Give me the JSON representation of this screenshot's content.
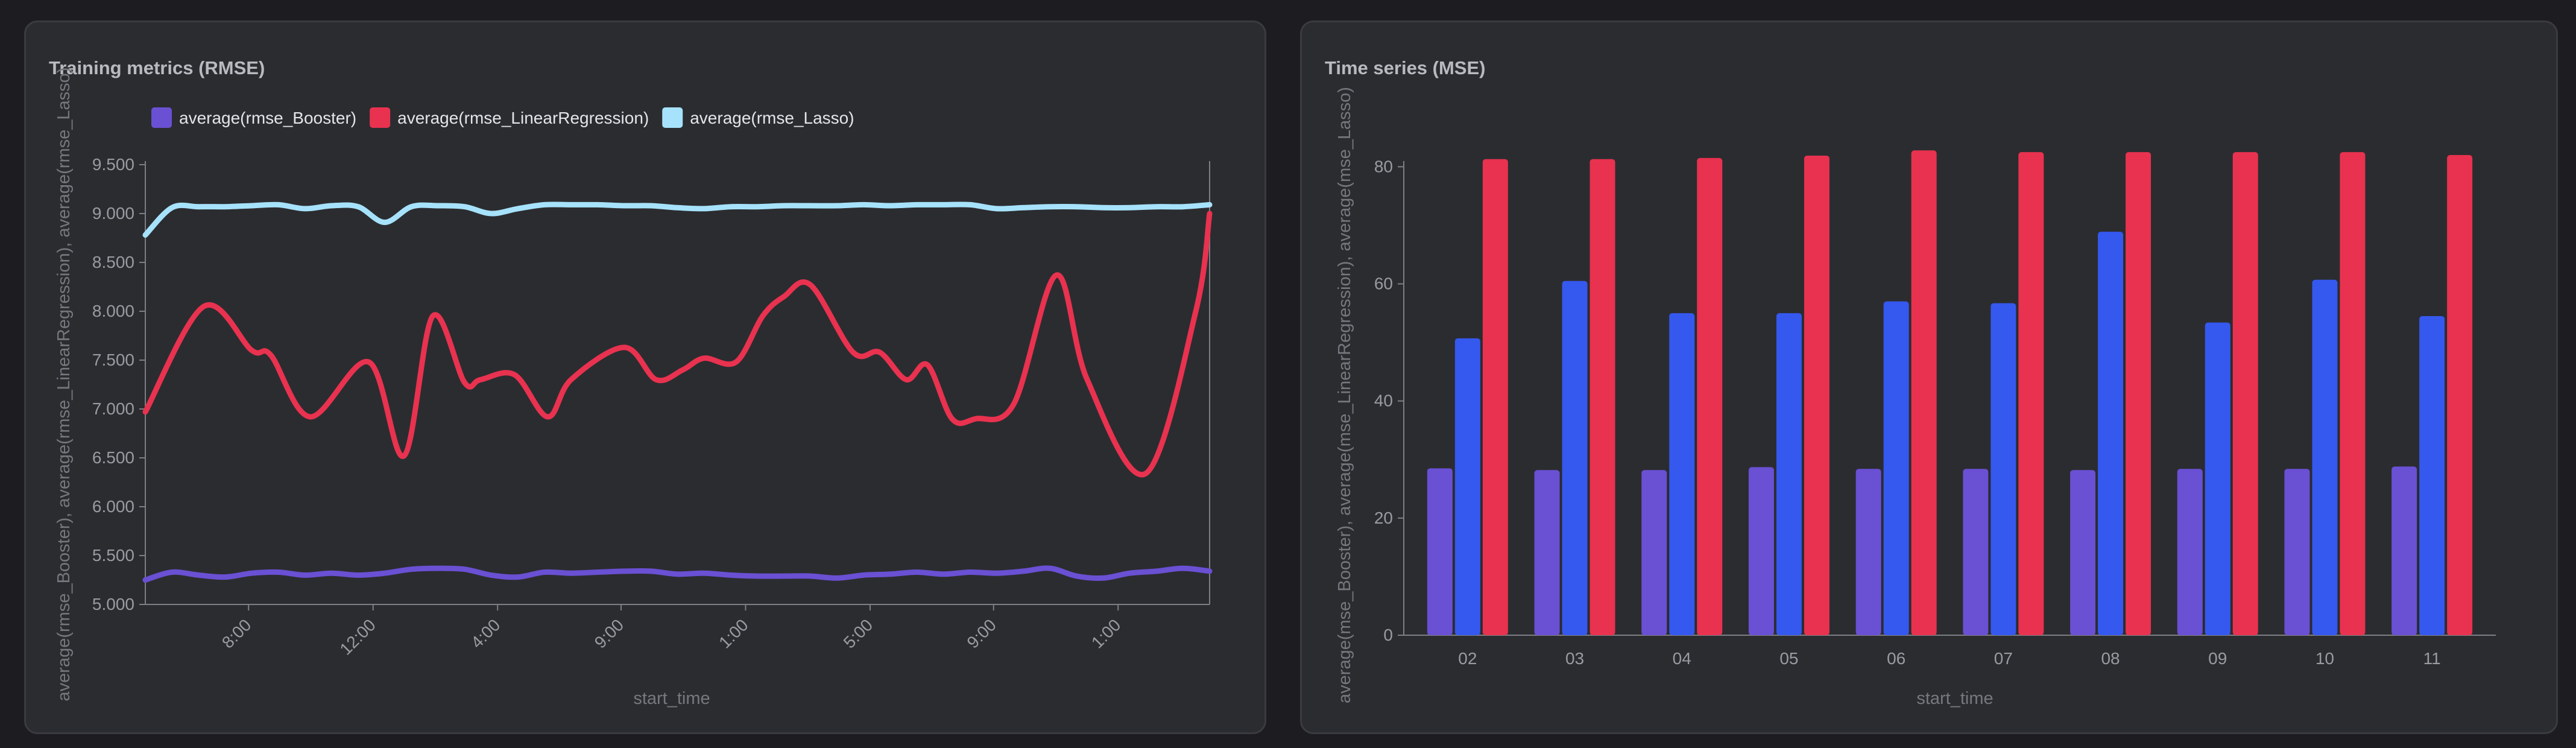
{
  "colors": {
    "booster": "#6a50d3",
    "linear": "#e8324f",
    "lasso": "#a6e2fb",
    "mse_booster": "#6a50d3",
    "mse_linear": "#3558ee",
    "mse_lasso": "#e8324f"
  },
  "panels": {
    "left": {
      "title": "Training metrics (RMSE)",
      "chart_data": {
        "type": "line",
        "title": "Training metrics (RMSE)",
        "xlabel": "start_time",
        "ylabel": "average(rmse_Booster), average(rmse_LinearRegression), average(rmse_Lasso)",
        "ylim": [
          5.0,
          9.5
        ],
        "y_ticks": [
          "5.000",
          "5.500",
          "6.000",
          "6.500",
          "7.000",
          "7.500",
          "8.000",
          "8.500",
          "9.000",
          "9.500"
        ],
        "x_range": [
          0,
          1.0
        ],
        "x_ticks": [
          {
            "x": 0.097,
            "label": "8:00"
          },
          {
            "x": 0.214,
            "label": "12:00"
          },
          {
            "x": 0.331,
            "label": "4:00"
          },
          {
            "x": 0.447,
            "label": "9:00"
          },
          {
            "x": 0.564,
            "label": "1:00"
          },
          {
            "x": 0.681,
            "label": "5:00"
          },
          {
            "x": 0.797,
            "label": "9:00"
          },
          {
            "x": 0.914,
            "label": "1:00"
          }
        ],
        "legend_position": "top-left",
        "series": [
          {
            "name": "average(rmse_Booster)",
            "color_key": "booster",
            "x": [
              0,
              0.025,
              0.05,
              0.075,
              0.1,
              0.125,
              0.15,
              0.175,
              0.2,
              0.225,
              0.25,
              0.275,
              0.3,
              0.325,
              0.35,
              0.375,
              0.4,
              0.425,
              0.45,
              0.475,
              0.5,
              0.525,
              0.55,
              0.575,
              0.6,
              0.625,
              0.65,
              0.675,
              0.7,
              0.725,
              0.75,
              0.775,
              0.8,
              0.825,
              0.85,
              0.875,
              0.9,
              0.925,
              0.95,
              0.975,
              1.0
            ],
            "values": [
              5.25,
              5.33,
              5.3,
              5.28,
              5.32,
              5.33,
              5.3,
              5.32,
              5.3,
              5.32,
              5.36,
              5.37,
              5.36,
              5.3,
              5.28,
              5.33,
              5.32,
              5.33,
              5.34,
              5.34,
              5.31,
              5.32,
              5.3,
              5.29,
              5.29,
              5.29,
              5.27,
              5.3,
              5.31,
              5.33,
              5.31,
              5.33,
              5.32,
              5.34,
              5.37,
              5.29,
              5.27,
              5.32,
              5.34,
              5.37,
              5.34
            ]
          },
          {
            "name": "average(rmse_LinearRegression)",
            "color_key": "linear",
            "x": [
              0,
              0.055,
              0.1,
              0.118,
              0.155,
              0.21,
              0.243,
              0.27,
              0.3,
              0.315,
              0.347,
              0.378,
              0.4,
              0.45,
              0.48,
              0.505,
              0.525,
              0.555,
              0.58,
              0.6,
              0.625,
              0.665,
              0.69,
              0.715,
              0.735,
              0.758,
              0.78,
              0.816,
              0.856,
              0.885,
              0.94,
              0.987,
              1.0
            ],
            "values": [
              6.97,
              8.05,
              7.6,
              7.55,
              6.92,
              7.48,
              6.52,
              7.95,
              7.27,
              7.3,
              7.35,
              6.92,
              7.3,
              7.63,
              7.3,
              7.4,
              7.52,
              7.48,
              7.95,
              8.15,
              8.27,
              7.58,
              7.58,
              7.3,
              7.45,
              6.9,
              6.9,
              7.05,
              8.37,
              7.3,
              6.34,
              8.0,
              9.0
            ]
          },
          {
            "name": "average(rmse_Lasso)",
            "color_key": "lasso",
            "x": [
              0,
              0.025,
              0.05,
              0.075,
              0.1,
              0.125,
              0.15,
              0.175,
              0.2,
              0.225,
              0.25,
              0.275,
              0.3,
              0.325,
              0.35,
              0.375,
              0.4,
              0.425,
              0.45,
              0.475,
              0.5,
              0.525,
              0.55,
              0.575,
              0.6,
              0.625,
              0.65,
              0.675,
              0.7,
              0.725,
              0.75,
              0.775,
              0.8,
              0.825,
              0.85,
              0.875,
              0.9,
              0.925,
              0.95,
              0.975,
              1.0
            ],
            "values": [
              8.78,
              9.06,
              9.07,
              9.07,
              9.08,
              9.09,
              9.05,
              9.08,
              9.07,
              8.91,
              9.07,
              9.08,
              9.07,
              9.0,
              9.05,
              9.09,
              9.09,
              9.09,
              9.08,
              9.08,
              9.06,
              9.05,
              9.07,
              9.07,
              9.08,
              9.08,
              9.08,
              9.09,
              9.08,
              9.09,
              9.09,
              9.09,
              9.05,
              9.06,
              9.07,
              9.07,
              9.06,
              9.06,
              9.07,
              9.07,
              9.09
            ]
          }
        ]
      }
    },
    "right": {
      "title": "Time series (MSE)",
      "chart_data": {
        "type": "bar",
        "title": "Time series (MSE)",
        "xlabel": "start_time",
        "ylabel": "average(mse_Booster), average(mse_LinearRegression), average(mse_Lasso)",
        "ylim": [
          0,
          82
        ],
        "y_ticks": [
          0,
          20,
          40,
          60,
          80
        ],
        "categories": [
          "02",
          "03",
          "04",
          "05",
          "06",
          "07",
          "08",
          "09",
          "10",
          "11"
        ],
        "series": [
          {
            "color_key": "mse_booster",
            "values": [
              28.5,
              28.2,
              28.2,
              28.7,
              28.4,
              28.4,
              28.2,
              28.4,
              28.4,
              28.8
            ]
          },
          {
            "color_key": "mse_linear",
            "values": [
              50.7,
              60.5,
              55.0,
              55.0,
              57.0,
              56.7,
              68.9,
              53.4,
              60.7,
              54.5
            ]
          },
          {
            "color_key": "mse_lasso",
            "values": [
              81.3,
              81.3,
              81.5,
              81.9,
              82.8,
              82.5,
              82.5,
              82.5,
              82.5,
              82.0
            ]
          }
        ]
      }
    }
  }
}
